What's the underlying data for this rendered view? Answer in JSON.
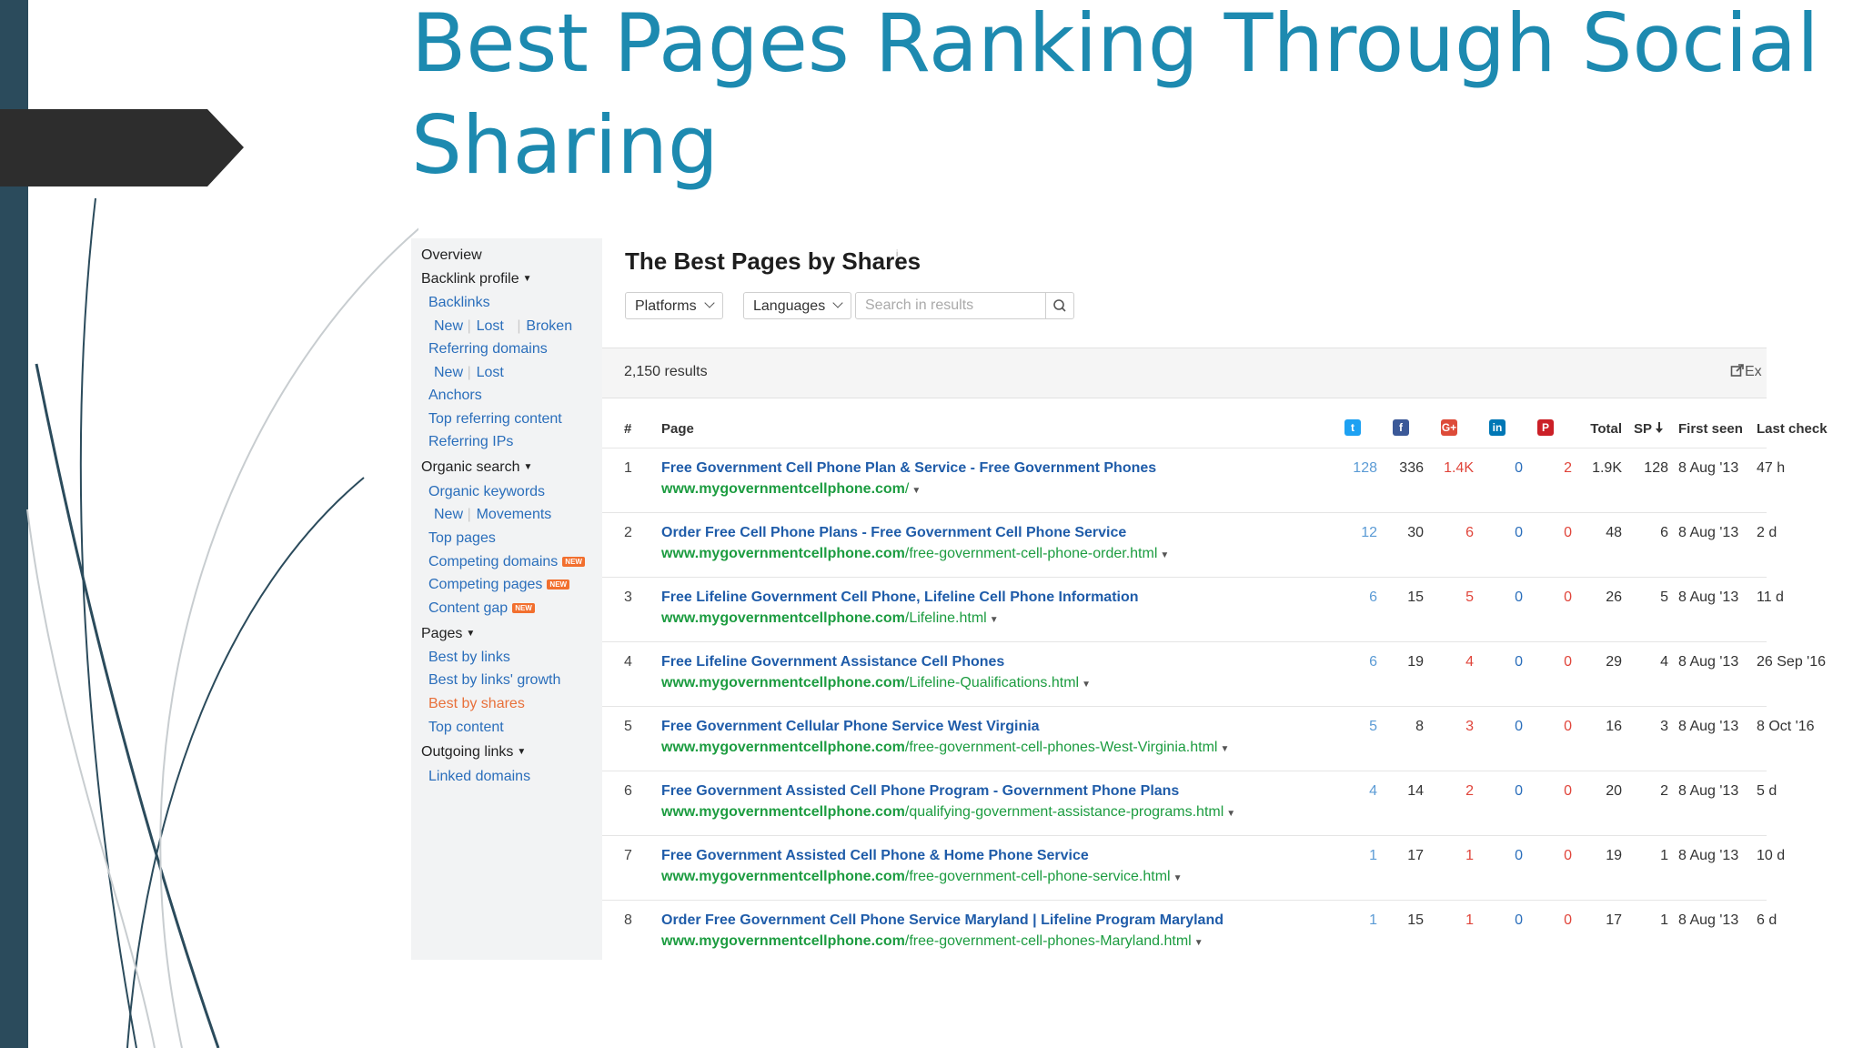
{
  "slide": {
    "title": "Best Pages Ranking Through Social Sharing",
    "colors": {
      "title": "#1d8ab0",
      "left_bar": "#2b4b5c",
      "tag": "#2d2d2d"
    }
  },
  "sidebar": {
    "items": [
      {
        "label": "Overview",
        "kind": "header",
        "caret": false
      },
      {
        "label": "Backlink profile",
        "kind": "header",
        "caret": true
      },
      {
        "label": "Backlinks",
        "kind": "link"
      },
      {
        "parts": [
          "New",
          "Lost",
          "Broken"
        ],
        "kind": "sublinks"
      },
      {
        "label": "Referring domains",
        "kind": "link"
      },
      {
        "parts": [
          "New",
          "Lost"
        ],
        "kind": "sublinks"
      },
      {
        "label": "Anchors",
        "kind": "link"
      },
      {
        "label": "Top referring content",
        "kind": "link"
      },
      {
        "label": "Referring IPs",
        "kind": "link"
      },
      {
        "label": "Organic search",
        "kind": "header",
        "caret": true
      },
      {
        "label": "Organic keywords",
        "kind": "link"
      },
      {
        "parts": [
          "New",
          "Movements"
        ],
        "kind": "sublinks"
      },
      {
        "label": "Top pages",
        "kind": "link"
      },
      {
        "label": "Competing domains",
        "kind": "link",
        "badge": "NEW"
      },
      {
        "label": "Competing pages",
        "kind": "link",
        "badge": "NEW"
      },
      {
        "label": "Content gap",
        "kind": "link",
        "badge": "NEW"
      },
      {
        "label": "Pages",
        "kind": "header",
        "caret": true
      },
      {
        "label": "Best by links",
        "kind": "link"
      },
      {
        "label": "Best by links' growth",
        "kind": "link"
      },
      {
        "label": "Best by shares",
        "kind": "link",
        "active": true
      },
      {
        "label": "Top content",
        "kind": "link"
      },
      {
        "label": "Outgoing links",
        "kind": "header",
        "caret": true
      },
      {
        "label": "Linked domains",
        "kind": "link"
      }
    ]
  },
  "main": {
    "title": "The Best Pages by Shares",
    "info_mark": "i",
    "filters": {
      "platforms": "Platforms",
      "languages": "Languages"
    },
    "search": {
      "placeholder": "Search in results",
      "value": ""
    },
    "results_count": "2,150 results",
    "export_label": "Ex"
  },
  "table": {
    "headers": {
      "num": "#",
      "page": "Page",
      "total": "Total",
      "sp": "SP",
      "first_seen": "First seen",
      "last_check": "Last check"
    },
    "social_icons": [
      {
        "name": "twitter-icon",
        "glyph": "t",
        "color": "#1da1f2"
      },
      {
        "name": "facebook-icon",
        "glyph": "f",
        "color": "#3b5998"
      },
      {
        "name": "google-plus-icon",
        "glyph": "G+",
        "color": "#dd4b39"
      },
      {
        "name": "linkedin-icon",
        "glyph": "in",
        "color": "#0077b5"
      },
      {
        "name": "pinterest-icon",
        "glyph": "P",
        "color": "#cb2027"
      }
    ],
    "rows": [
      {
        "num": "1",
        "title": "Free Government Cell Phone Plan & Service - Free Government Phones",
        "domain": "www.mygovernmentcellphone.com",
        "path": "/",
        "tw": "128",
        "fb": "336",
        "gp": "1.4K",
        "li": "0",
        "pin": "2",
        "total": "1.9K",
        "sp": "128",
        "first_seen": "8 Aug '13",
        "last_check": "47 h"
      },
      {
        "num": "2",
        "title": "Order Free Cell Phone Plans - Free Government Cell Phone Service",
        "domain": "www.mygovernmentcellphone.com",
        "path": "/free-government-cell-phone-order.html",
        "tw": "12",
        "fb": "30",
        "gp": "6",
        "li": "0",
        "pin": "0",
        "total": "48",
        "sp": "6",
        "first_seen": "8 Aug '13",
        "last_check": "2 d"
      },
      {
        "num": "3",
        "title": "Free Lifeline Government Cell Phone, Lifeline Cell Phone Information",
        "domain": "www.mygovernmentcellphone.com",
        "path": "/Lifeline.html",
        "tw": "6",
        "fb": "15",
        "gp": "5",
        "li": "0",
        "pin": "0",
        "total": "26",
        "sp": "5",
        "first_seen": "8 Aug '13",
        "last_check": "11 d"
      },
      {
        "num": "4",
        "title": "Free Lifeline Government Assistance Cell Phones",
        "domain": "www.mygovernmentcellphone.com",
        "path": "/Lifeline-Qualifications.html",
        "tw": "6",
        "fb": "19",
        "gp": "4",
        "li": "0",
        "pin": "0",
        "total": "29",
        "sp": "4",
        "first_seen": "8 Aug '13",
        "last_check": "26 Sep '16"
      },
      {
        "num": "5",
        "title": "Free Government Cellular Phone Service West Virginia",
        "domain": "www.mygovernmentcellphone.com",
        "path": "/free-government-cell-phones-West-Virginia.html",
        "tw": "5",
        "fb": "8",
        "gp": "3",
        "li": "0",
        "pin": "0",
        "total": "16",
        "sp": "3",
        "first_seen": "8 Aug '13",
        "last_check": "8 Oct '16"
      },
      {
        "num": "6",
        "title": "Free Government Assisted Cell Phone Program - Government Phone Plans",
        "domain": "www.mygovernmentcellphone.com",
        "path": "/qualifying-government-assistance-programs.html",
        "tw": "4",
        "fb": "14",
        "gp": "2",
        "li": "0",
        "pin": "0",
        "total": "20",
        "sp": "2",
        "first_seen": "8 Aug '13",
        "last_check": "5 d"
      },
      {
        "num": "7",
        "title": "Free Government Assisted Cell Phone & Home Phone Service",
        "domain": "www.mygovernmentcellphone.com",
        "path": "/free-government-cell-phone-service.html",
        "tw": "1",
        "fb": "17",
        "gp": "1",
        "li": "0",
        "pin": "0",
        "total": "19",
        "sp": "1",
        "first_seen": "8 Aug '13",
        "last_check": "10 d"
      },
      {
        "num": "8",
        "title": "Order Free Government Cell Phone Service Maryland | Lifeline Program Maryland",
        "domain": "www.mygovernmentcellphone.com",
        "path": "/free-government-cell-phones-Maryland.html",
        "tw": "1",
        "fb": "15",
        "gp": "1",
        "li": "0",
        "pin": "0",
        "total": "17",
        "sp": "1",
        "first_seen": "8 Aug '13",
        "last_check": "6 d"
      }
    ]
  }
}
